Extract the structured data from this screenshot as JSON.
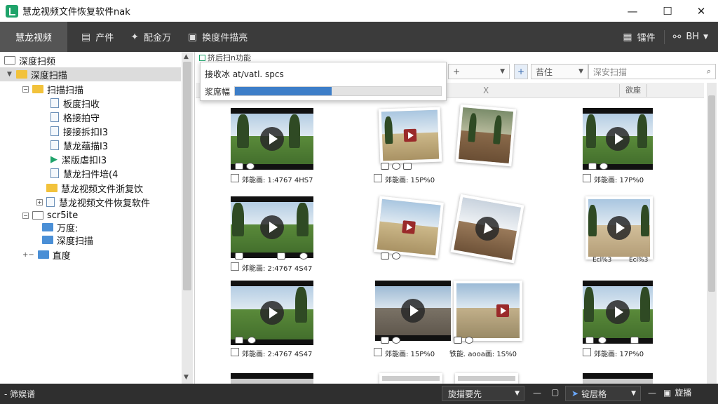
{
  "window": {
    "title": "慧龙视频文件恢复软件nak",
    "minimize": "—",
    "maximize": "☐",
    "close": "✕"
  },
  "toolbar": {
    "brand": "慧龙视频",
    "items": [
      {
        "icon": "document-icon",
        "label": "产件"
      },
      {
        "icon": "tools-icon",
        "label": "配金万"
      },
      {
        "icon": "scan-file-icon",
        "label": "换度件描亮"
      }
    ],
    "right": [
      {
        "icon": "building-icon",
        "label": "镭件"
      },
      {
        "icon": "link-icon",
        "label": "BH"
      }
    ]
  },
  "tree": {
    "items": [
      {
        "label": "深度扫频"
      },
      {
        "label": "深度扫描"
      },
      {
        "label": "扫描扫描"
      },
      {
        "label": "板度扫收"
      },
      {
        "label": "格接拍守"
      },
      {
        "label": "接接拆扣I3"
      },
      {
        "label": "慧龙蕴描I3"
      },
      {
        "label": "潔版虐扣I3"
      },
      {
        "label": "慧龙扫件培(4"
      },
      {
        "label": "慧龙视频文件浙复饮"
      },
      {
        "label": "慧龙视频文件恢复软件"
      },
      {
        "label": "scr5ite"
      },
      {
        "label": "万度:"
      },
      {
        "label": "深度扫描"
      },
      {
        "label": "直度"
      }
    ]
  },
  "progress": {
    "title": "挤后扫n功能",
    "file": "接收冰 at/vatl. spcs",
    "label": "浆席幅",
    "value": 0.47
  },
  "filters": {
    "type_value": "+",
    "view_icon": "+",
    "sort_value": "苔住",
    "search_placeholder": "深安扫描",
    "search_icon": "filter-icon"
  },
  "columns": {
    "col1": "X",
    "col2": "欲座"
  },
  "thumbs": {
    "captions": [
      "郊能画:  1:4767  4HS7",
      "郊能画:  15P%0",
      "郊能画:  17P%0",
      "郊能画:  2:4767  4S47",
      "郊能画:  2:4767  4S47",
      "郊能画:  15P%0",
      "铁能. aooa画:  1S%0",
      "郊能画:  17P%0"
    ],
    "side_labels": {
      "left": "Ecl%3",
      "right": "Ecl%3"
    }
  },
  "statusbar": {
    "left": "- 筛娱谱",
    "select1": "旋描要先",
    "select2": "锭层格",
    "button": "旋播"
  }
}
